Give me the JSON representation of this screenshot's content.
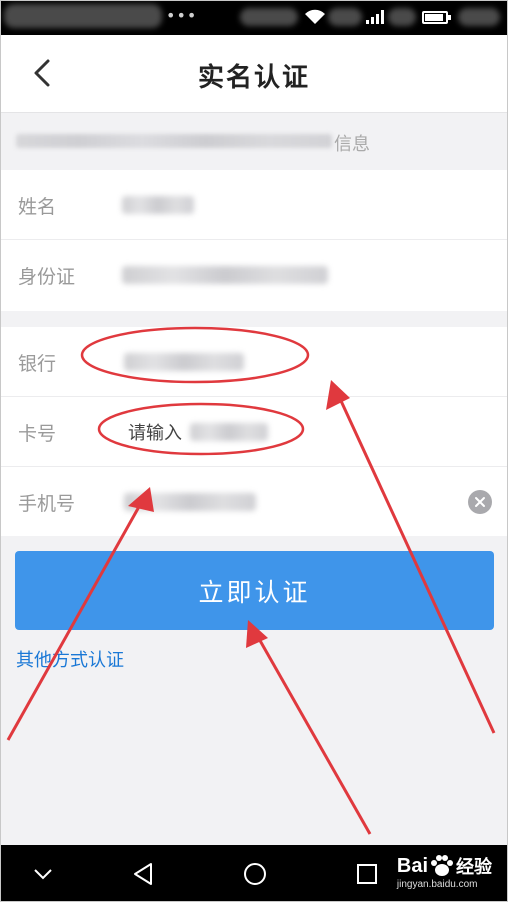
{
  "header": {
    "title": "实名认证"
  },
  "notice": {
    "text_suffix": "信息"
  },
  "form": {
    "name_label": "姓名",
    "id_label": "身份证",
    "bank_label": "银行",
    "card_label": "卡号",
    "card_placeholder": "请输入",
    "phone_label": "手机号"
  },
  "actions": {
    "verify_button": "立即认证",
    "other_methods_link": "其他方式认证"
  },
  "watermark": {
    "brand": "Bai",
    "brand_cn": "经验",
    "url": "jingyan.baidu.com"
  },
  "colors": {
    "primary": "#3f95ea",
    "link": "#1a78d6",
    "annotation": "#e0393e"
  },
  "icons": [
    "back-chevron-icon",
    "clear-icon",
    "wifi-icon",
    "signal-icon",
    "battery-icon",
    "nav-back-icon",
    "nav-home-icon",
    "nav-recent-icon",
    "nav-collapse-icon",
    "paw-icon"
  ]
}
